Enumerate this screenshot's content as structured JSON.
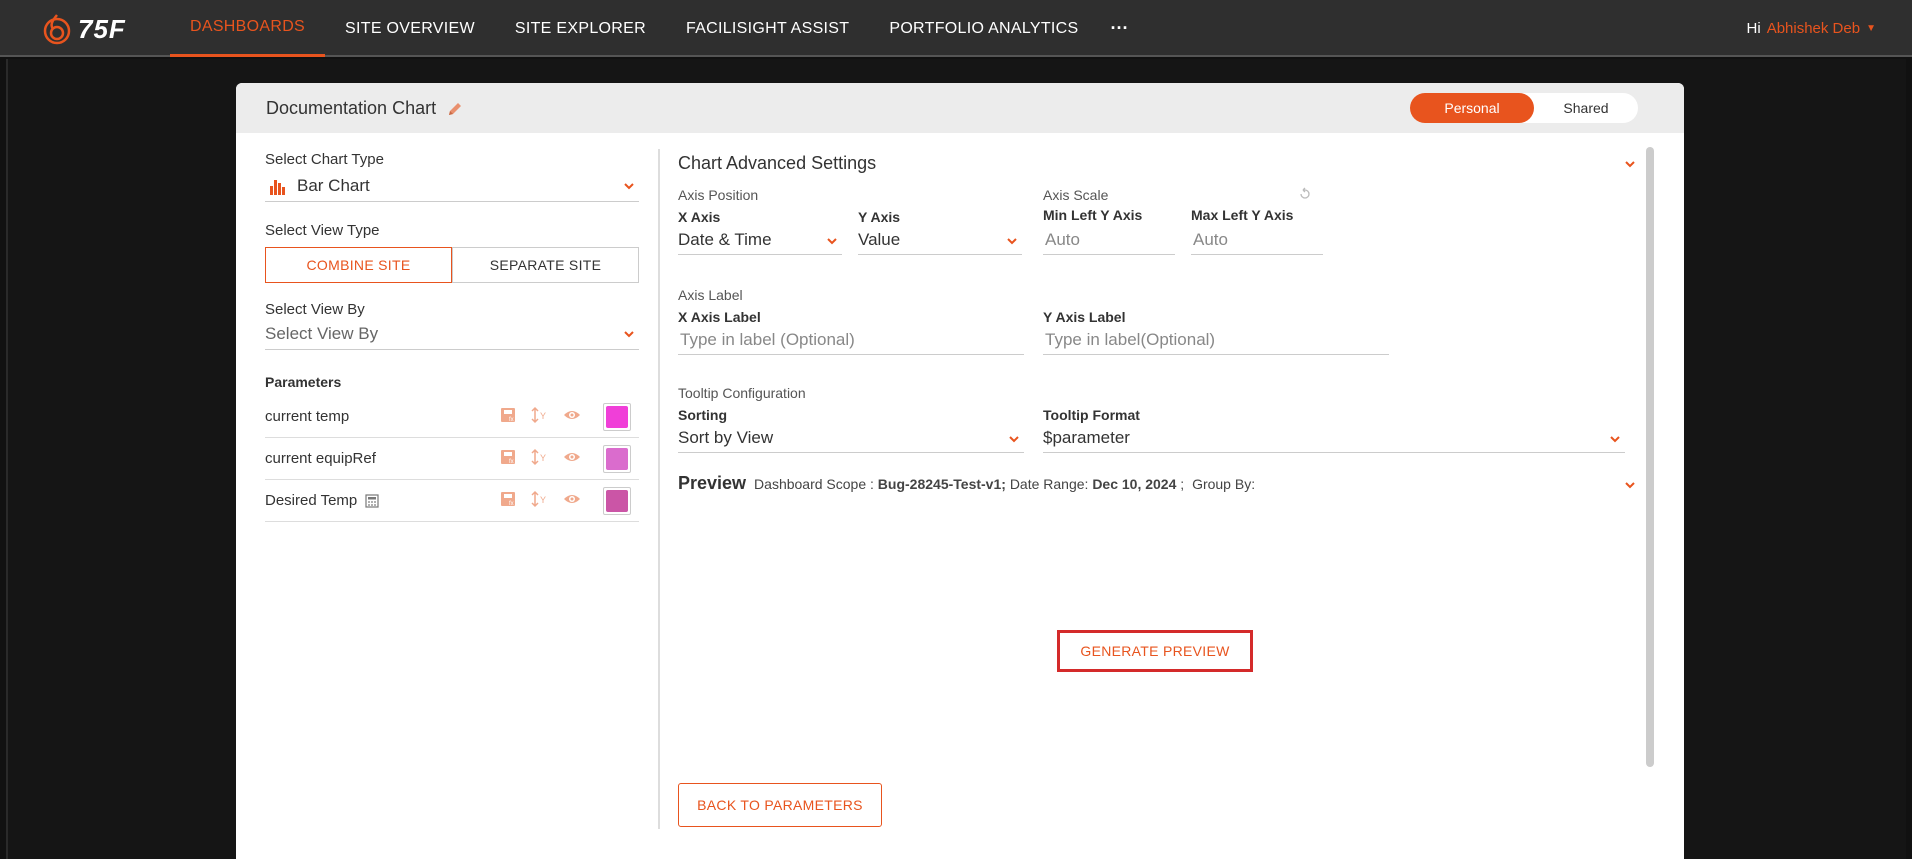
{
  "app": {
    "logo_text": "75F"
  },
  "nav": {
    "items": [
      {
        "label": "DASHBOARDS",
        "active": true
      },
      {
        "label": "SITE OVERVIEW",
        "active": false
      },
      {
        "label": "SITE EXPLORER",
        "active": false
      },
      {
        "label": "FACILISIGHT ASSIST",
        "active": false
      },
      {
        "label": "PORTFOLIO ANALYTICS",
        "active": false
      }
    ],
    "more": "···"
  },
  "user": {
    "greeting": "Hi",
    "name": "Abhishek Deb"
  },
  "modal": {
    "title": "Documentation Chart",
    "toggle": {
      "personal": "Personal",
      "shared": "Shared"
    }
  },
  "left": {
    "chart_type_label": "Select Chart Type",
    "chart_type_value": "Bar Chart",
    "view_type_label": "Select View Type",
    "view_type_options": [
      "COMBINE SITE",
      "SEPARATE SITE"
    ],
    "view_by_label": "Select View By",
    "view_by_placeholder": "Select View By",
    "parameters_label": "Parameters",
    "parameters": [
      {
        "name": "current temp",
        "color": "#f03fd8"
      },
      {
        "name": "current equipRef",
        "color": "#da6ccd"
      },
      {
        "name": "Desired Temp",
        "color": "#cb55a6"
      }
    ]
  },
  "advanced": {
    "title": "Chart Advanced Settings",
    "axis_position_label": "Axis Position",
    "x_axis_label": "X Axis",
    "x_axis_value": "Date & Time",
    "y_axis_label": "Y Axis",
    "y_axis_value": "Value",
    "axis_scale_label": "Axis Scale",
    "min_left_y_label": "Min Left Y Axis",
    "min_left_y_placeholder": "Auto",
    "max_left_y_label": "Max Left Y Axis",
    "max_left_y_placeholder": "Auto",
    "axis_label_section": "Axis Label",
    "x_axis_label_title": "X Axis Label",
    "x_axis_label_placeholder": "Type in label (Optional)",
    "y_axis_label_title": "Y Axis Label",
    "y_axis_label_placeholder": "Type in label(Optional)",
    "tooltip_section": "Tooltip Configuration",
    "sorting_label": "Sorting",
    "sorting_value": "Sort by View",
    "tooltip_format_label": "Tooltip Format",
    "tooltip_format_value": "$parameter"
  },
  "preview": {
    "title": "Preview",
    "scope_label": "Dashboard Scope :",
    "scope_value": "Bug-28245-Test-v1;",
    "date_label": "Date Range:",
    "date_value": "Dec 10, 2024",
    "date_sep": ";",
    "group_label": "Group By:",
    "generate_button": "GENERATE PREVIEW",
    "back_button": "BACK TO PARAMETERS"
  },
  "colors": {
    "accent": "#e8541e",
    "nav_bg": "#2f2f2f",
    "highlight": "#d42a2a"
  }
}
